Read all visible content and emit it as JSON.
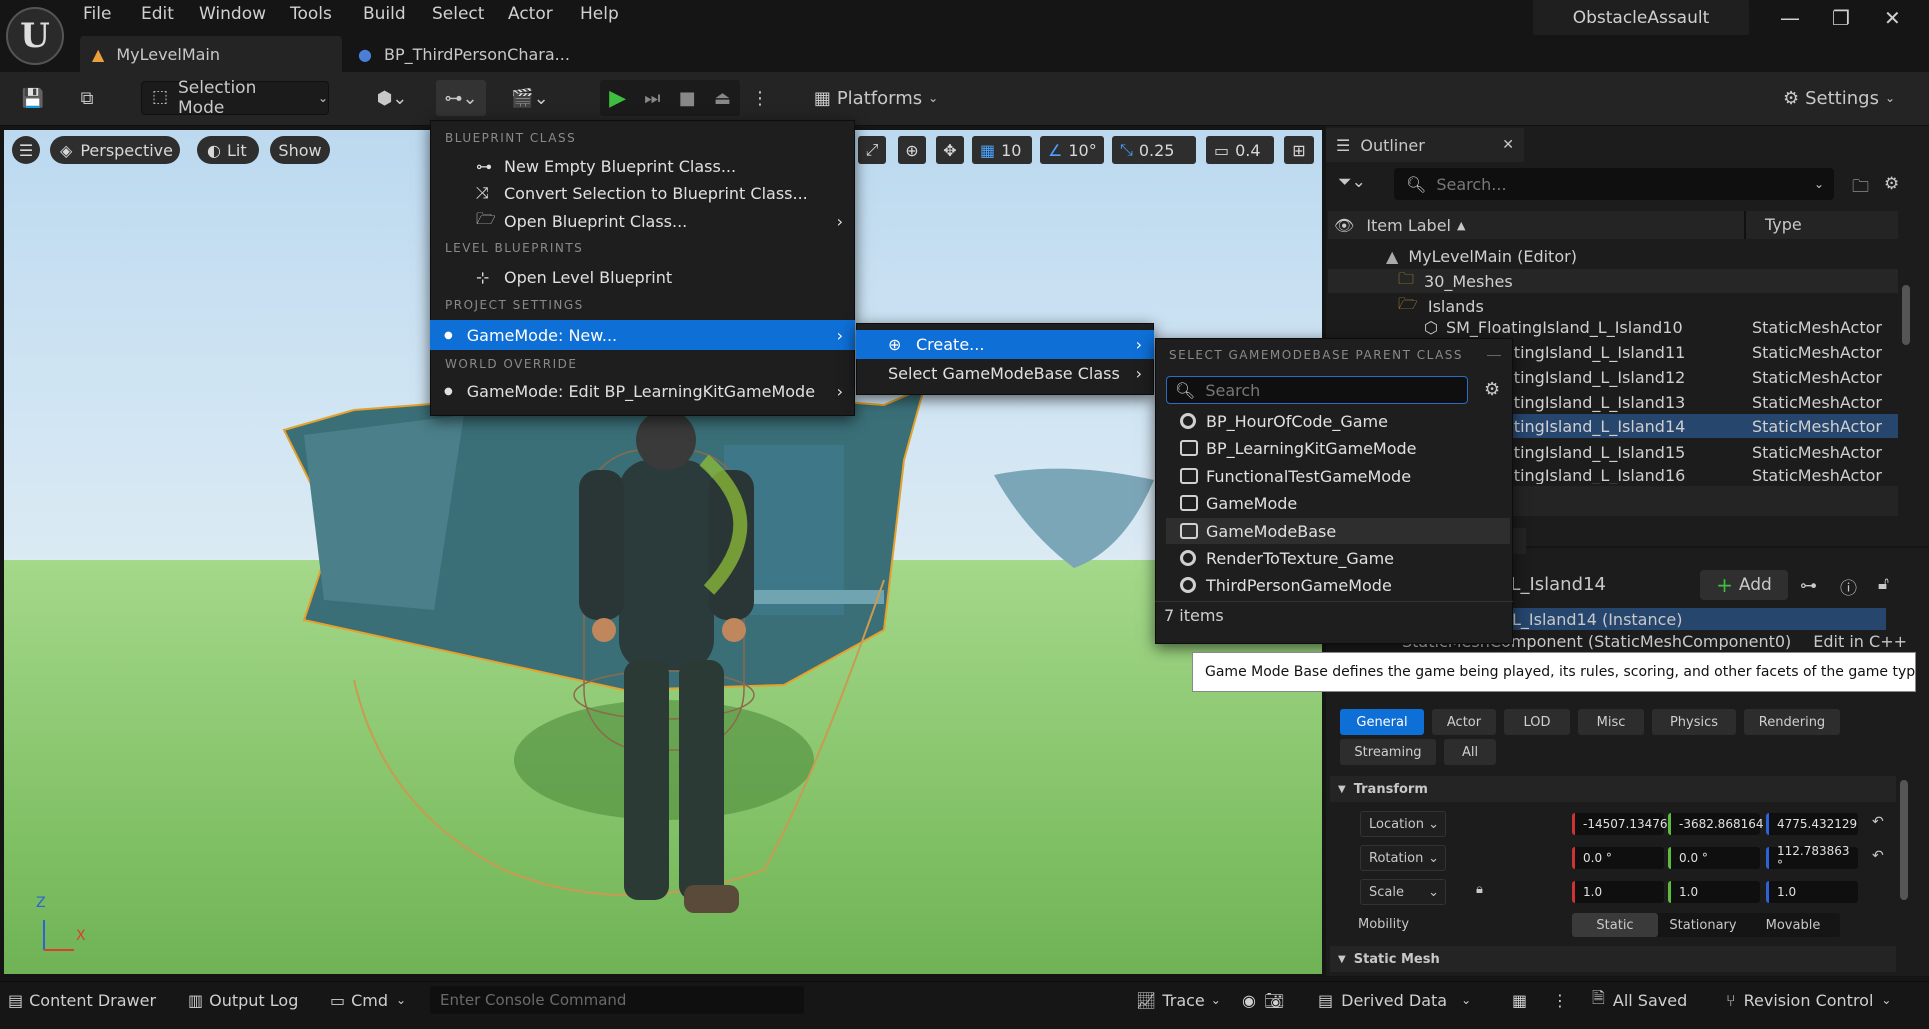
{
  "menu": {
    "items": [
      "File",
      "Edit",
      "Window",
      "Tools",
      "Build",
      "Select",
      "Actor",
      "Help"
    ]
  },
  "project_name": "ObstacleAssault",
  "tabs": [
    {
      "label": "MyLevelMain"
    },
    {
      "label": "BP_ThirdPersonChara..."
    }
  ],
  "toolbar": {
    "selection_mode": "Selection Mode",
    "platforms": "Platforms",
    "settings": "Settings"
  },
  "viewport": {
    "perspective": "Perspective",
    "lit": "Lit",
    "show": "Show",
    "grid": "10",
    "angle": "10°",
    "scale": "0.25",
    "camera": "0.4",
    "axis_z": "Z",
    "axis_x": "X"
  },
  "blueprint_menu": {
    "section_class": "BLUEPRINT CLASS",
    "new_empty": "New Empty Blueprint Class...",
    "convert": "Convert Selection to Blueprint Class...",
    "open_class": "Open Blueprint Class...",
    "section_level": "LEVEL BLUEPRINTS",
    "open_level": "Open Level Blueprint",
    "section_project": "PROJECT SETTINGS",
    "gamemode_new": "GameMode: New...",
    "section_world": "WORLD OVERRIDE",
    "gamemode_edit": "GameMode: Edit BP_LearningKitGameMode"
  },
  "submenu": {
    "create": "Create...",
    "select_base": "Select GameModeBase Class"
  },
  "class_picker": {
    "header": "SELECT GAMEMODEBASE PARENT CLASS",
    "search_placeholder": "Search",
    "items": [
      {
        "label": "BP_HourOfCode_Game",
        "icon": "radio"
      },
      {
        "label": "BP_LearningKitGameMode",
        "icon": "gamepad"
      },
      {
        "label": "FunctionalTestGameMode",
        "icon": "gamepad"
      },
      {
        "label": "GameMode",
        "icon": "gamepad"
      },
      {
        "label": "GameModeBase",
        "icon": "gamepad"
      },
      {
        "label": "RenderToTexture_Game",
        "icon": "radio"
      },
      {
        "label": "ThirdPersonGameMode",
        "icon": "radio"
      }
    ],
    "count": "7 items",
    "tooltip": "Game Mode Base defines the game being played, its rules, scoring, and other facets of the game type."
  },
  "outliner": {
    "title": "Outliner",
    "search_placeholder": "Search...",
    "col_label": "Item Label",
    "col_type": "Type",
    "rows": [
      {
        "label": "MyLevelMain (Editor)",
        "type": ""
      },
      {
        "label": "30_Meshes",
        "type": ""
      },
      {
        "label": "Islands",
        "type": ""
      },
      {
        "label": "SM_FloatingIsland_L_Island10",
        "type": "StaticMeshActor"
      },
      {
        "label": "atingIsland_L_Island11",
        "type": "StaticMeshActor"
      },
      {
        "label": "atingIsland_L_Island12",
        "type": "StaticMeshActor"
      },
      {
        "label": "atingIsland_L_Island13",
        "type": "StaticMeshActor"
      },
      {
        "label": "atingIsland_L_Island14",
        "type": "StaticMeshActor"
      },
      {
        "label": "atingIsland_L_Island15",
        "type": "StaticMeshActor"
      },
      {
        "label": "atingIsland_L_Island16",
        "type": "StaticMeshActor"
      }
    ],
    "partial": ")"
  },
  "details": {
    "name": "d_L_Island14",
    "add": "Add",
    "instance": "_L_Island14 (Instance)",
    "component": "StaticMeshComponent (StaticMeshComponent0)",
    "edit_cpp": "Edit in C++",
    "filters": [
      "General",
      "Actor",
      "LOD",
      "Misc",
      "Physics",
      "Rendering",
      "Streaming",
      "All"
    ],
    "transform": "Transform",
    "location_label": "Location",
    "location": [
      "-14507.13476",
      "-3682.868164",
      "4775.432129"
    ],
    "rotation_label": "Rotation",
    "rotation": [
      "0.0 °",
      "0.0 °",
      "112.783863 °"
    ],
    "scale_label": "Scale",
    "scale": [
      "1.0",
      "1.0",
      "1.0"
    ],
    "mobility_label": "Mobility",
    "mobility": [
      "Static",
      "Stationary",
      "Movable"
    ],
    "static_mesh": "Static Mesh"
  },
  "statusbar": {
    "content_drawer": "Content Drawer",
    "output_log": "Output Log",
    "cmd": "Cmd",
    "console_placeholder": "Enter Console Command",
    "trace": "Trace",
    "derived_data": "Derived Data",
    "all_saved": "All Saved",
    "revision_control": "Revision Control"
  },
  "colors": {
    "accent": "#0e6fd6",
    "play": "#3fbf3f",
    "selection": "#26466e"
  }
}
